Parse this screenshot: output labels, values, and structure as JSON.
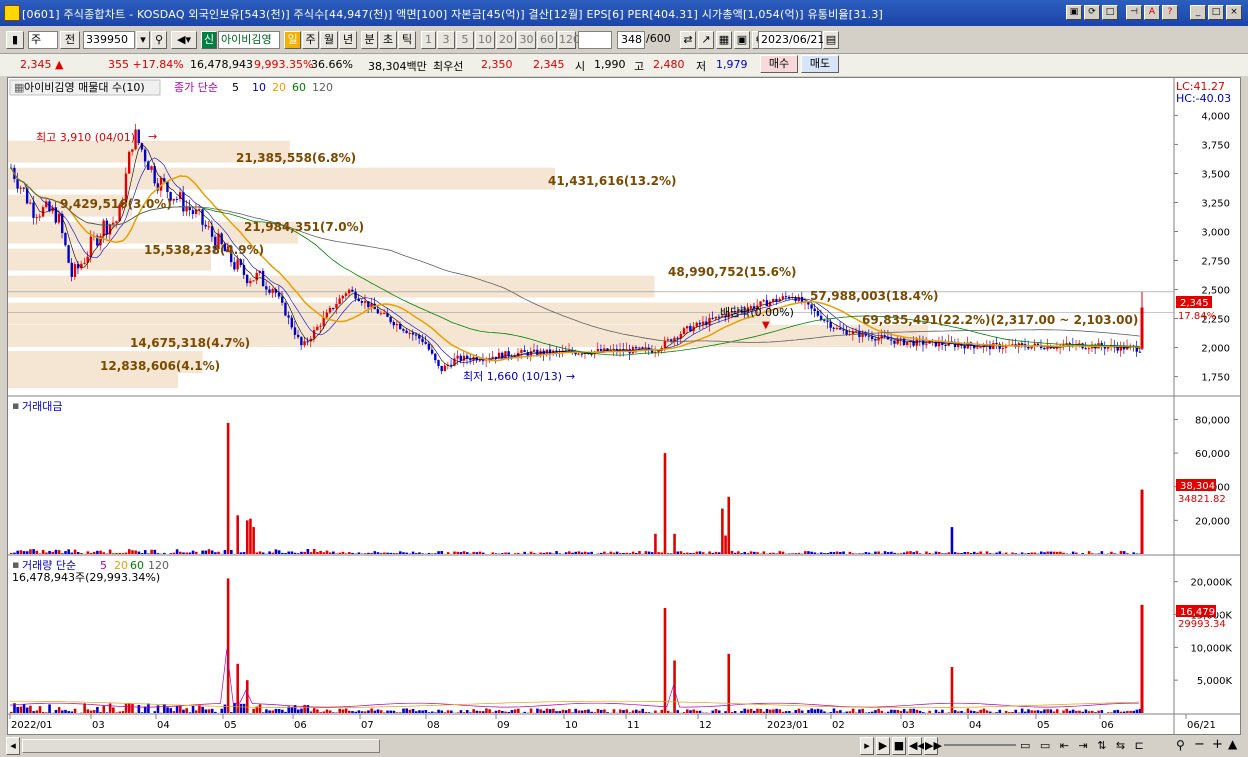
{
  "window": {
    "title": "[0601] 주식종합차트 - KOSDAQ 외국인보유[543(천)] 주식수[44,947(천)] 액면[100] 자본금[45(억)] 결산[12월] EPS[6] PER[404.31] 시가총액[1,054(억)] 유통비율[31.3]"
  },
  "toolbar": {
    "period_type": "주",
    "prev_label": "전",
    "code": "339950",
    "badge": "신",
    "stock_name": "아이비김영",
    "intervals": [
      "일",
      "주",
      "월",
      "년",
      "분",
      "초",
      "틱"
    ],
    "numbers": [
      "1",
      "3",
      "5",
      "10",
      "20",
      "30",
      "60",
      "120"
    ],
    "count_display": "348",
    "count_total": "/600",
    "date": "2023/06/21"
  },
  "quote": {
    "price": "2,345 ▲",
    "change": "355 +17.84%",
    "volume": "16,478,943",
    "volume_ratio": "9,993.35%",
    "ratio2": "36.66%",
    "value": "38,304백만",
    "best_ask_label": "최우선",
    "best_ask": "2,350",
    "best_bid": "2,345",
    "open_label": "시",
    "open": "1,990",
    "high_label": "고",
    "high": "2,480",
    "low_label": "저",
    "low": "1,979",
    "buy_label": "매수",
    "sell_label": "매도"
  },
  "price_panel": {
    "title": "아이비김영 매물대 수(10)",
    "ma_title": "종가 단순",
    "ma_periods": [
      "5",
      "10",
      "20",
      "60",
      "120"
    ],
    "lc": "LC:41.27",
    "hc": "HC:-40.03",
    "last_price": "2,345",
    "last_change": "17.84%",
    "y_ticks": [
      "4,000",
      "3,750",
      "3,500",
      "3,250",
      "3,000",
      "2,750",
      "2,500",
      "2,250",
      "2,000",
      "1,750"
    ],
    "high_mark": "최고 3,910 (04/01)",
    "low_mark": "최저 1,660 (10/13)",
    "dividend_label": "배당락(0.00%)",
    "volume_profile": [
      "21,385,558(6.8%)",
      "41,431,616(13.2%)",
      "9,429,516(3.0%)",
      "21,984,351(7.0%)",
      "15,538,238(4.9%)",
      "48,990,752(15.6%)",
      "57,988,003(18.4%)",
      "69,835,491(22.2%)(2,317.00 ~ 2,103.00)",
      "14,675,318(4.7%)",
      "12,838,606(4.1%)"
    ]
  },
  "amount_panel": {
    "title": "거래대금",
    "y_ticks": [
      "80,000",
      "60,000",
      "40,000",
      "20,000"
    ],
    "last_value": "38,304",
    "ma_value": "34821.82"
  },
  "volume_panel": {
    "title": "거래량 단순",
    "ma_periods": [
      "5",
      "20",
      "60",
      "120"
    ],
    "summary": "16,478,943주(29,993.34%)",
    "y_ticks": [
      "20,000K",
      "15,000K",
      "10,000K",
      "5,000K"
    ],
    "last_value": "16,479K",
    "ma_value": "29993.34"
  },
  "x_axis": [
    "2022/01",
    "03",
    "04",
    "05",
    "06",
    "07",
    "08",
    "09",
    "10",
    "11",
    "12",
    "2023/01",
    "02",
    "03",
    "04",
    "05",
    "06",
    "06/21"
  ],
  "colors": {
    "up": "#e00000",
    "down": "#0000c8",
    "ma5": "#000000",
    "ma20": "#e8a000",
    "ma60": "#008000",
    "ma120": "#606060",
    "profile": "#f5e6d3"
  },
  "chart_data": {
    "type": "candlestick",
    "price_axis": {
      "ylim": [
        1600,
        4150
      ]
    },
    "volume_profile_levels": [
      {
        "price": 3688,
        "pct": 6.8
      },
      {
        "price": 3455,
        "pct": 13.2
      },
      {
        "price": 3223,
        "pct": 3.0
      },
      {
        "price": 2990,
        "pct": 7.0
      },
      {
        "price": 2758,
        "pct": 4.9
      },
      {
        "price": 2525,
        "pct": 15.6
      },
      {
        "price": 2293,
        "pct": 18.4
      },
      {
        "price": 2100,
        "pct": 22.2
      },
      {
        "price": 1875,
        "pct": 4.7
      },
      {
        "price": 1745,
        "pct": 4.1
      }
    ],
    "high": {
      "value": 3910,
      "date": "04/01"
    },
    "low": {
      "value": 1660,
      "date": "10/13"
    },
    "last": {
      "price": 2345,
      "change_pct": 17.84,
      "amount": 38304,
      "volume_k": 16479
    }
  }
}
